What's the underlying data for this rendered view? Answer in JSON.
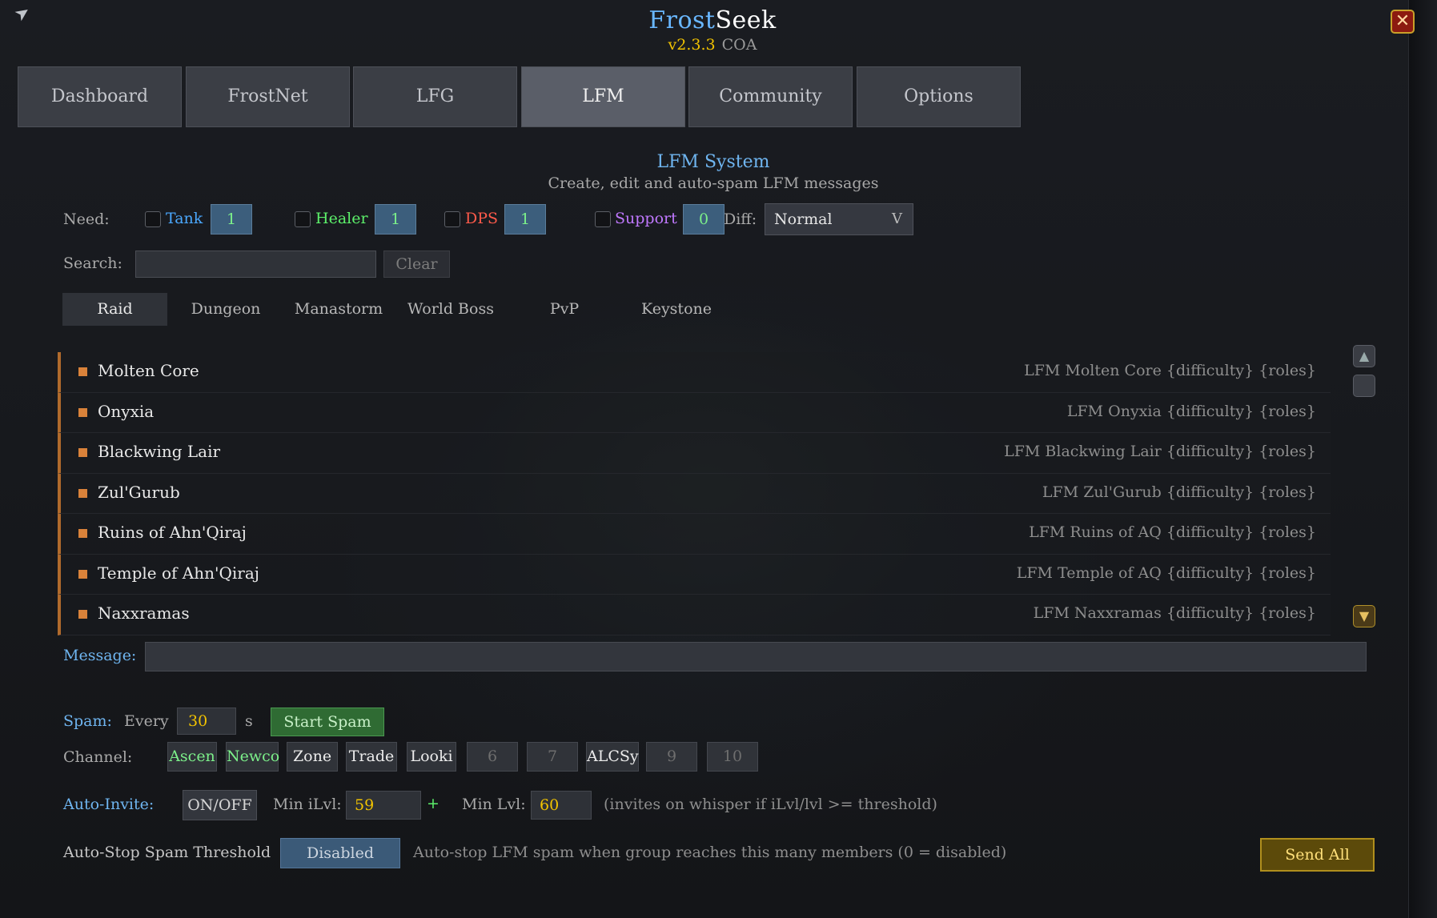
{
  "header": {
    "title_part1": "Frost",
    "title_part2": "Seek",
    "version": "v2.3.3",
    "realm": "COA",
    "close_icon": "close-icon"
  },
  "tabs": [
    {
      "label": "Dashboard",
      "active": false
    },
    {
      "label": "FrostNet",
      "active": false
    },
    {
      "label": "LFG",
      "active": false
    },
    {
      "label": "LFM",
      "active": true
    },
    {
      "label": "Community",
      "active": false
    },
    {
      "label": "Options",
      "active": false
    }
  ],
  "section": {
    "title": "LFM System",
    "subtitle": "Create, edit and auto-spam LFM messages"
  },
  "need": {
    "label": "Need:",
    "roles": [
      {
        "label": "Tank",
        "count": "1",
        "color": "#4aa8ff"
      },
      {
        "label": "Healer",
        "count": "1",
        "color": "#5cf06a"
      },
      {
        "label": "DPS",
        "count": "1",
        "color": "#ff5a4a"
      },
      {
        "label": "Support",
        "count": "0",
        "color": "#c078ff"
      }
    ],
    "diff_label": "Diff:",
    "diff_value": "Normal",
    "diff_arrow": "V"
  },
  "search": {
    "label": "Search:",
    "value": "",
    "clear_label": "Clear"
  },
  "categories": [
    {
      "label": "Raid",
      "active": true
    },
    {
      "label": "Dungeon",
      "active": false
    },
    {
      "label": "Manastorm",
      "active": false
    },
    {
      "label": "World Boss",
      "active": false
    },
    {
      "label": "PvP",
      "active": false
    },
    {
      "label": "Keystone",
      "active": false
    }
  ],
  "raids": [
    {
      "name": "Molten Core",
      "template": "LFM Molten Core {difficulty} {roles}"
    },
    {
      "name": "Onyxia",
      "template": "LFM Onyxia {difficulty} {roles}"
    },
    {
      "name": "Blackwing Lair",
      "template": "LFM Blackwing Lair {difficulty} {roles}"
    },
    {
      "name": "Zul'Gurub",
      "template": "LFM Zul'Gurub {difficulty} {roles}"
    },
    {
      "name": "Ruins of Ahn'Qiraj",
      "template": "LFM Ruins of AQ {difficulty} {roles}"
    },
    {
      "name": "Temple of Ahn'Qiraj",
      "template": "LFM Temple of AQ {difficulty} {roles}"
    },
    {
      "name": "Naxxramas",
      "template": "LFM Naxxramas {difficulty} {roles}"
    }
  ],
  "message": {
    "label": "Message:",
    "value": ""
  },
  "spam": {
    "label": "Spam:",
    "every_label": "Every",
    "interval": "30",
    "unit": "s",
    "start_label": "Start Spam"
  },
  "channel": {
    "label": "Channel:",
    "items": [
      "Ascen",
      "Newco",
      "Zone",
      "Trade",
      "Looki",
      "6",
      "7",
      "ALCSy",
      "9",
      "10"
    ]
  },
  "auto_invite": {
    "label": "Auto-Invite:",
    "toggle_label": "ON/OFF",
    "min_ilvl_label": "Min iLvl:",
    "min_ilvl": "59",
    "plus": "+",
    "min_lvl_label": "Min Lvl:",
    "min_lvl": "60",
    "hint": "(invites on whisper if iLvl/lvl >= threshold)"
  },
  "auto_stop": {
    "label": "Auto-Stop Spam Threshold",
    "value": "Disabled",
    "hint": "Auto-stop LFM spam when group reaches this many members (0 = disabled)"
  },
  "send_all_label": "Send All"
}
